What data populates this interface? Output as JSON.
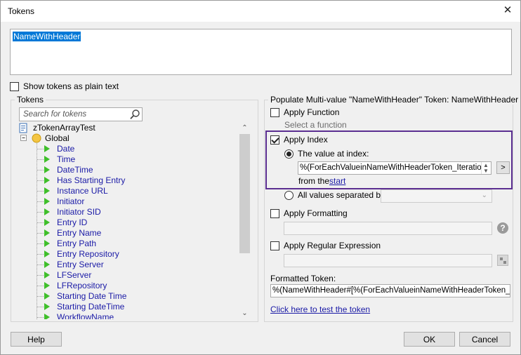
{
  "window": {
    "title": "Tokens"
  },
  "token_text": {
    "value": "NameWithHeader"
  },
  "show_plain": {
    "label": "Show tokens as plain text",
    "checked": false
  },
  "tokens_panel": {
    "title": "Tokens",
    "search_placeholder": "Search for tokens",
    "root": "zTokenArrayTest",
    "global": "Global",
    "items": [
      "Date",
      "Time",
      "DateTime",
      "Has Starting Entry",
      "Instance URL",
      "Initiator",
      "Initiator SID",
      "Entry ID",
      "Entry Name",
      "Entry Path",
      "Entry Repository",
      "Entry Server",
      "LFServer",
      "LFRepository",
      "Starting Date Time",
      "Starting DateTime",
      "WorkflowName"
    ]
  },
  "populate": {
    "title": "Populate Multi-value \"NameWithHeader\" Token: NameWithHeader",
    "apply_function": {
      "label": "Apply Function",
      "checked": false,
      "hint": "Select a function"
    },
    "apply_index": {
      "label": "Apply Index",
      "checked": true
    },
    "value_at_index": {
      "label": "The value at index:",
      "value": "%(ForEachValueinNameWithHeaderToken_Iteration)",
      "arrow": ">"
    },
    "from_the": {
      "label": "from the",
      "link": "start"
    },
    "all_values": {
      "label": "All values separated by:"
    },
    "apply_formatting": {
      "label": "Apply Formatting",
      "checked": false
    },
    "apply_regex": {
      "label": "Apply Regular Expression",
      "checked": false
    },
    "formatted_token": {
      "label": "Formatted Token:",
      "value": "%(NameWithHeader#[%(ForEachValueinNameWithHeaderToken_Iteration)])"
    },
    "test_link": "Click here to test the token"
  },
  "footer": {
    "help": "Help",
    "ok": "OK",
    "cancel": "Cancel"
  },
  "colors": {
    "accent_frame": "#5b2e91",
    "selection": "#0078d7",
    "link": "#1a1aa6",
    "play_green": "#3fbf2a"
  }
}
